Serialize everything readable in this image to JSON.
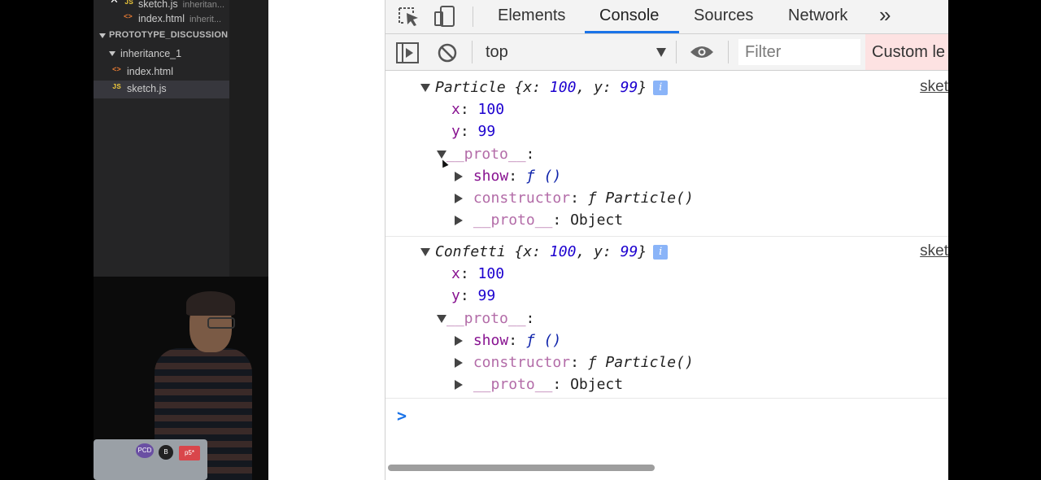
{
  "sidebar": {
    "open_editors": [
      {
        "icon": "JS",
        "name": "sketch.js",
        "hint": "inheritan..."
      },
      {
        "icon": "<>",
        "name": "index.html",
        "hint": "inherit..."
      }
    ],
    "folder": "PROTOTYPE_DISCUSSION",
    "subfolder": "inheritance_1",
    "files": [
      {
        "icon": "<>",
        "name": "index.html"
      },
      {
        "icon": "JS",
        "name": "sketch.js"
      }
    ]
  },
  "webcam": {
    "stickers": [
      "PCD",
      "p5*",
      "B"
    ]
  },
  "devtools": {
    "tabs": [
      "Elements",
      "Console",
      "Sources",
      "Network"
    ],
    "more_tabs": "»",
    "active_tab": "Console",
    "toolbar": {
      "context": "top",
      "filter_placeholder": "Filter",
      "levels": "Custom le"
    },
    "console": {
      "messages": [
        {
          "header_name": "Particle",
          "header_rest_open": " {",
          "x_key": "x",
          "x_val": "100",
          "y_key": "y",
          "y_val": "99",
          "source": "sket",
          "proto_label": "__proto__",
          "show_key": "show",
          "show_val": "ƒ ()",
          "constructor_key": "constructor",
          "constructor_val": "ƒ Particle()",
          "inner_proto_key": "__proto__",
          "inner_proto_val": "Object"
        },
        {
          "header_name": "Confetti",
          "header_rest_open": " {",
          "x_key": "x",
          "x_val": "100",
          "y_key": "y",
          "y_val": "99",
          "source": "sket",
          "proto_label": "__proto__",
          "show_key": "show",
          "show_val": "ƒ ()",
          "constructor_key": "constructor",
          "constructor_val": "ƒ Particle()",
          "inner_proto_key": "__proto__",
          "inner_proto_val": "Object"
        }
      ],
      "prompt": ">"
    }
  },
  "colors": {
    "active_tab_underline": "#1a73e8",
    "key_color": "#881391",
    "number_color": "#1c00cf",
    "levels_bg": "#fde2e2"
  }
}
